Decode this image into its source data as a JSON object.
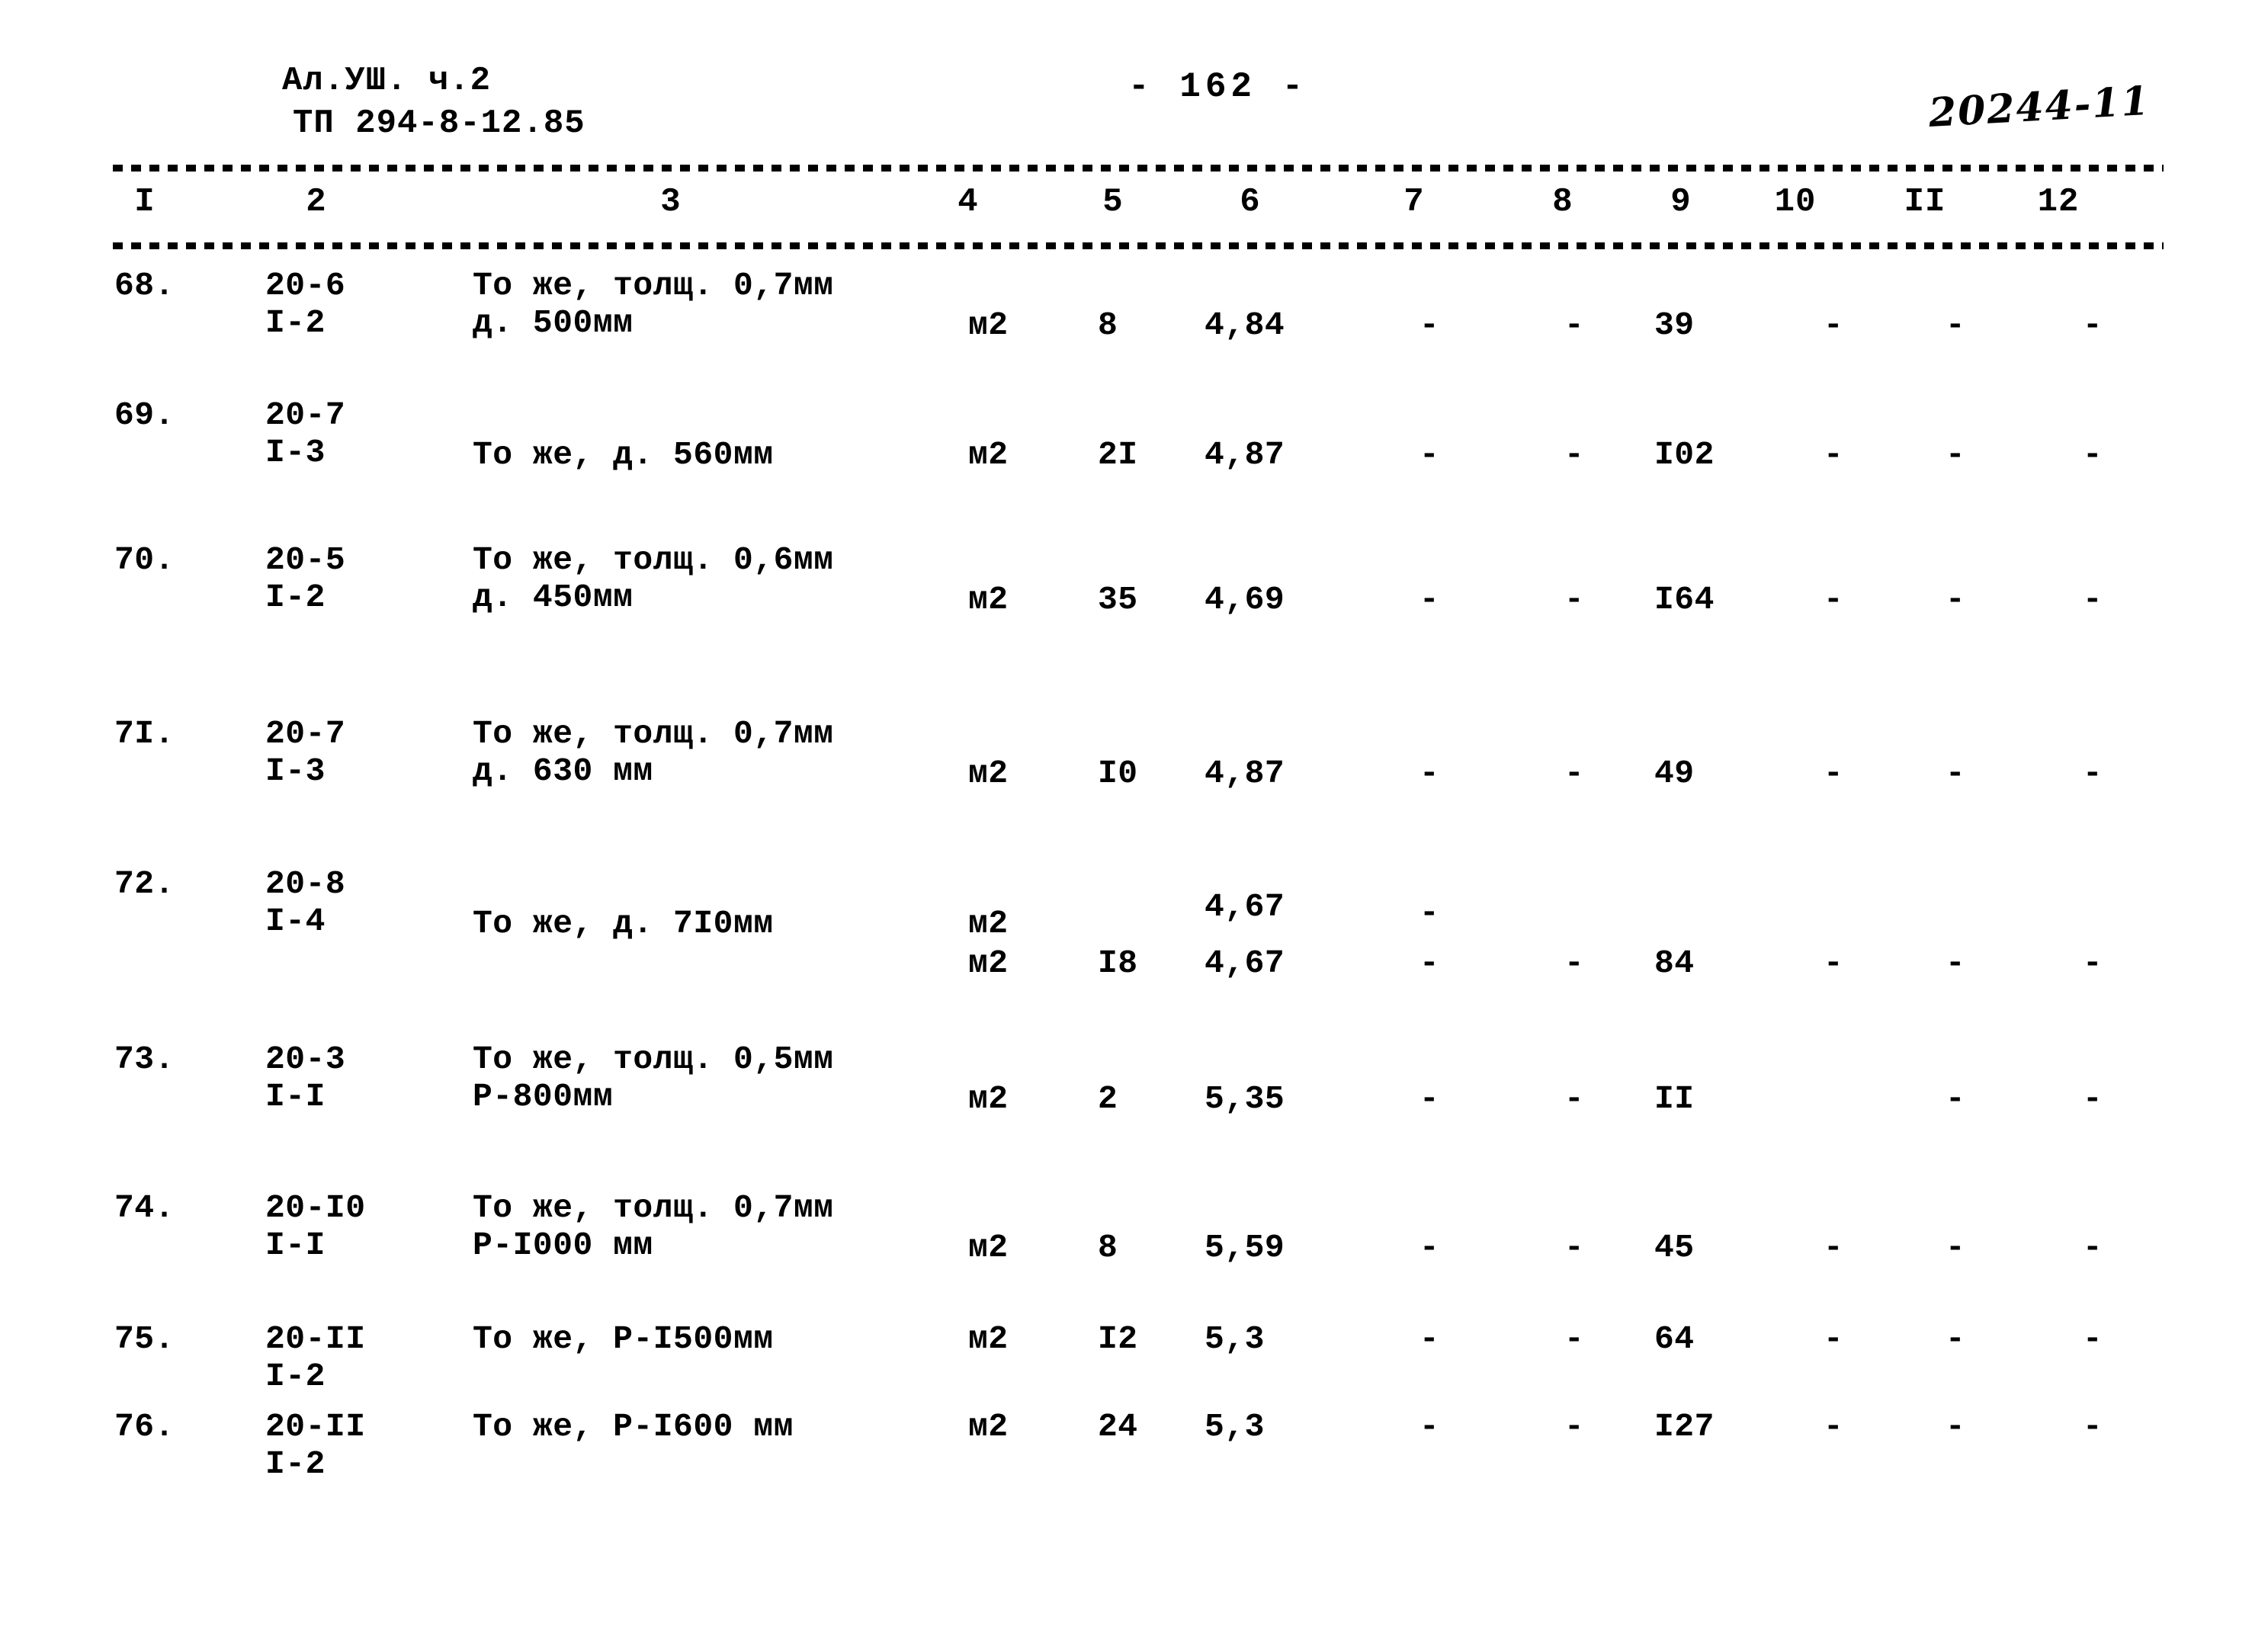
{
  "header": {
    "doc_series": "Ал.УШ.  ч.2",
    "doc_code": "ТП 294-8-12.85",
    "page_number": "- 162 -",
    "handwritten_code": "20244-11"
  },
  "table": {
    "column_headers": [
      "I",
      "2",
      "3",
      "4",
      "5",
      "6",
      "7",
      "8",
      "9",
      "10",
      "II",
      "12"
    ],
    "rows": [
      {
        "num": "68.",
        "code_line1": "20-6",
        "code_line2": "I-2",
        "desc_line1": "То же, толщ. 0,7мм",
        "desc_line2": "д. 500мм",
        "unit": "м2",
        "c5": "8",
        "c6": "4,84",
        "c7": "-",
        "c8": "-",
        "c9": "39",
        "c10": "-",
        "c11": "-",
        "c12": "-"
      },
      {
        "num": "69.",
        "code_line1": "20-7",
        "code_line2": "I-3",
        "desc_line1": "",
        "desc_line2": "То же, д. 560мм",
        "unit": "м2",
        "c5": "2I",
        "c6": "4,87",
        "c7": "-",
        "c8": "-",
        "c9": "I02",
        "c10": "-",
        "c11": "-",
        "c12": "-"
      },
      {
        "num": "70.",
        "code_line1": "20-5",
        "code_line2": "I-2",
        "desc_line1": "То же, толщ. 0,6мм",
        "desc_line2": "д. 450мм",
        "unit": "м2",
        "c5": "35",
        "c6": "4,69",
        "c7": "-",
        "c8": "-",
        "c9": "I64",
        "c10": "-",
        "c11": "-",
        "c12": "-"
      },
      {
        "num": "7I.",
        "code_line1": "20-7",
        "code_line2": "I-3",
        "desc_line1": "То же, толщ. 0,7мм",
        "desc_line2": "д. 630 мм",
        "unit": "м2",
        "c5": "I0",
        "c6": "4,87",
        "c7": "-",
        "c8": "-",
        "c9": "49",
        "c10": "-",
        "c11": "-",
        "c12": "-"
      },
      {
        "num": "72.",
        "code_line1": "20-8",
        "code_line2": "I-4",
        "desc_line1": "",
        "desc_line2": "То же, д. 7I0мм",
        "unit": "м2",
        "unit_b": "м2",
        "c5": "",
        "c5b": "I8",
        "c6": "4,67",
        "c6b": "4,67",
        "c7": "-",
        "c7b": "-",
        "c8": "-",
        "c9": "84",
        "c10": "-",
        "c11": "-",
        "c12": "-"
      },
      {
        "num": "73.",
        "code_line1": "20-3",
        "code_line2": "I-I",
        "desc_line1": "То же, толщ. 0,5мм",
        "desc_line2": "Р-800мм",
        "unit": "м2",
        "c5": "2",
        "c6": "5,35",
        "c7": "-",
        "c8": "-",
        "c9": "II",
        "c10": "",
        "c11": "-",
        "c12": "-"
      },
      {
        "num": "74.",
        "code_line1": "20-I0",
        "code_line2": "I-I",
        "desc_line1": "То же, толщ. 0,7мм",
        "desc_line2": "Р-I000 мм",
        "unit": "м2",
        "c5": "8",
        "c6": "5,59",
        "c7": "-",
        "c8": "-",
        "c9": "45",
        "c10": "-",
        "c11": "-",
        "c12": "-"
      },
      {
        "num": "75.",
        "code_line1": "20-II",
        "code_line2": "I-2",
        "desc_line1": "То же, Р-I500мм",
        "desc_line2": "",
        "unit": "м2",
        "c5": "I2",
        "c6": "5,3",
        "c7": "-",
        "c8": "-",
        "c9": "64",
        "c10": "-",
        "c11": "-",
        "c12": "-"
      },
      {
        "num": "76.",
        "code_line1": "20-II",
        "code_line2": "I-2",
        "desc_line1": "То же, Р-I600 мм",
        "desc_line2": "",
        "unit": "м2",
        "c5": "24",
        "c6": "5,3",
        "c7": "-",
        "c8": "-",
        "c9": "I27",
        "c10": "-",
        "c11": "-",
        "c12": "-"
      }
    ]
  }
}
